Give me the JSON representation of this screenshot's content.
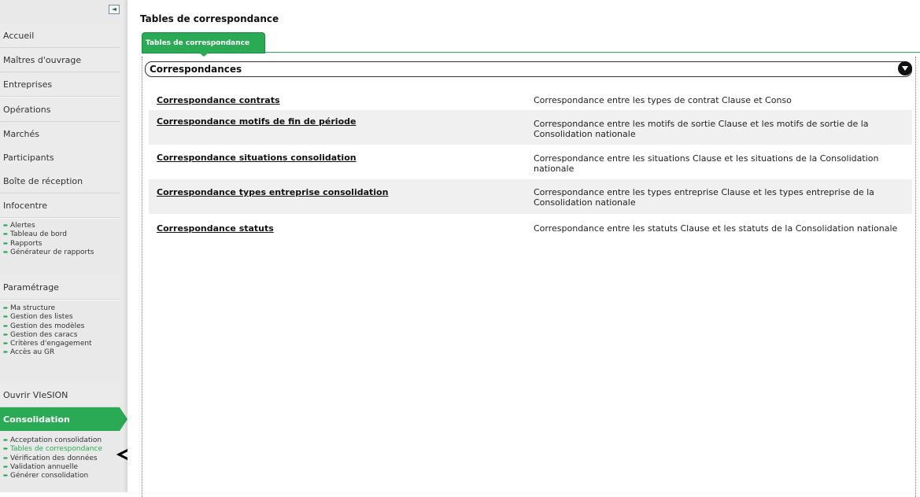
{
  "sidebar": {
    "nav": [
      {
        "label": "Accueil"
      },
      {
        "label": "Maîtres d'ouvrage"
      },
      {
        "label": "Entreprises"
      },
      {
        "label": "Opérations"
      },
      {
        "label": "Marchés"
      },
      {
        "label": "Participants"
      },
      {
        "label": "Boîte de réception"
      },
      {
        "label": "Infocentre"
      },
      {
        "label": "Paramétrage"
      },
      {
        "label": "Ouvrir VIeSION"
      },
      {
        "label": "Consolidation"
      }
    ],
    "infocentre_items": [
      "Alertes",
      "Tableau de bord",
      "Rapports",
      "Générateur de rapports"
    ],
    "parametrage_items": [
      "Ma structure",
      "Gestion des listes",
      "Gestion des modèles",
      "Gestion des caracs",
      "Critères d'engagement",
      "Accès au GR"
    ],
    "consolidation_items": [
      "Acceptation consolidation",
      "Tables de correspondance",
      "Vérification des données",
      "Validation annuelle",
      "Générer consolidation"
    ],
    "active_item": "Consolidation",
    "current_subitem": "Tables de correspondance"
  },
  "main": {
    "title": "Tables de correspondance",
    "tab_label": "Tables de correspondance",
    "section_title": "Correspondances",
    "rows": [
      {
        "link": "Correspondance contrats",
        "desc": "Correspondance entre les types de contrat Clause et Conso"
      },
      {
        "link": "Correspondance motifs de fin de période",
        "desc": "Correspondance entre les motifs de sortie Clause et les motifs de sortie de la Consolidation nationale"
      },
      {
        "link": "Correspondance situations consolidation",
        "desc": "Correspondance entre les situations Clause et les situations de la Consolidation nationale"
      },
      {
        "link": "Correspondance types entreprise consolidation",
        "desc": "Correspondance entre les types entreprise Clause et les types entreprise de la Consolidation nationale"
      },
      {
        "link": "Correspondance statuts",
        "desc": "Correspondance entre les statuts Clause et les statuts de la Consolidation nationale"
      }
    ]
  },
  "colors": {
    "accent": "#2aaa55",
    "sidebar_bg": "#e9e9e9",
    "row_alt": "#f0f0f0"
  },
  "icons": {
    "collapse": "collapse-sidebar-icon",
    "bullet": "green-arrow-icon",
    "section_toggle": "chevron-down-icon",
    "annotation": "left-arrow-annotation-icon"
  }
}
